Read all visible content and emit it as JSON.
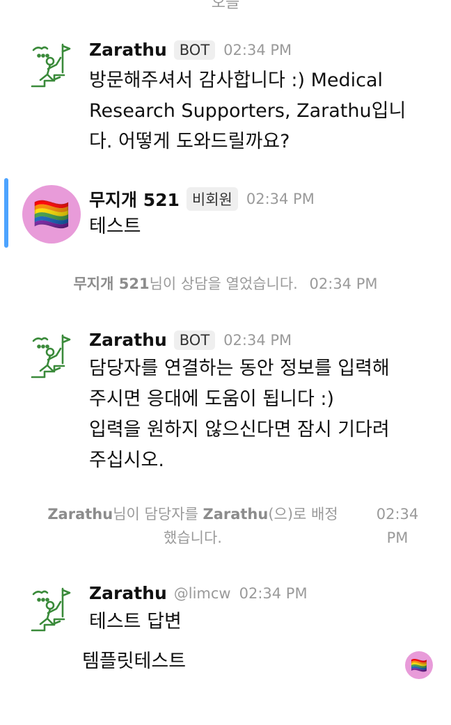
{
  "top_partial_text": "오늘",
  "messages": [
    {
      "name": "Zarathu",
      "badge": "BOT",
      "time": "02:34 PM",
      "lines": [
        "방문해주셔서 감사합니다 :) Medical",
        "Research Supporters, Zarathu입니",
        "다. 어떻게 도와드릴까요?"
      ]
    },
    {
      "name": "무지개 521",
      "badge": "비회원",
      "time": "02:34 PM",
      "avatar_emoji": "🏳️‍🌈",
      "lines": [
        "테스트"
      ]
    },
    {
      "name": "Zarathu",
      "badge": "BOT",
      "time": "02:34 PM",
      "lines": [
        "담당자를 연결하는 동안 정보를 입력해",
        "주시면 응대에 도움이 됩니다 :)",
        "입력을 원하지 않으신다면 잠시 기다려",
        "주십시오."
      ]
    },
    {
      "name": "Zarathu",
      "handle": "@limcw",
      "time": "02:34 PM",
      "lines": [
        "테스트 답변"
      ]
    }
  ],
  "system_events": [
    {
      "actor": "무지개 521",
      "text": "님이 상담을 열었습니다.",
      "time": "02:34 PM"
    },
    {
      "actor": "Zarathu",
      "text_mid": "님이 담당자를 ",
      "assignee": "Zarathu",
      "text_end_1": "(으)로 배정",
      "text_end_2": "했습니다.",
      "time_1": "02:34",
      "time_2": "PM"
    }
  ],
  "template_message": "템플릿테스트",
  "reader_avatar_emoji": "🏳️‍🌈",
  "colors": {
    "accent": "#4da3ff",
    "user_avatar_bg": "#e89bd9",
    "muted_text": "#9a9a9a",
    "bot_icon": "#3a8a3a"
  },
  "icons": {
    "bot_avatar": "zarathu-logo-icon",
    "user_avatar": "rainbow-flag-icon"
  }
}
